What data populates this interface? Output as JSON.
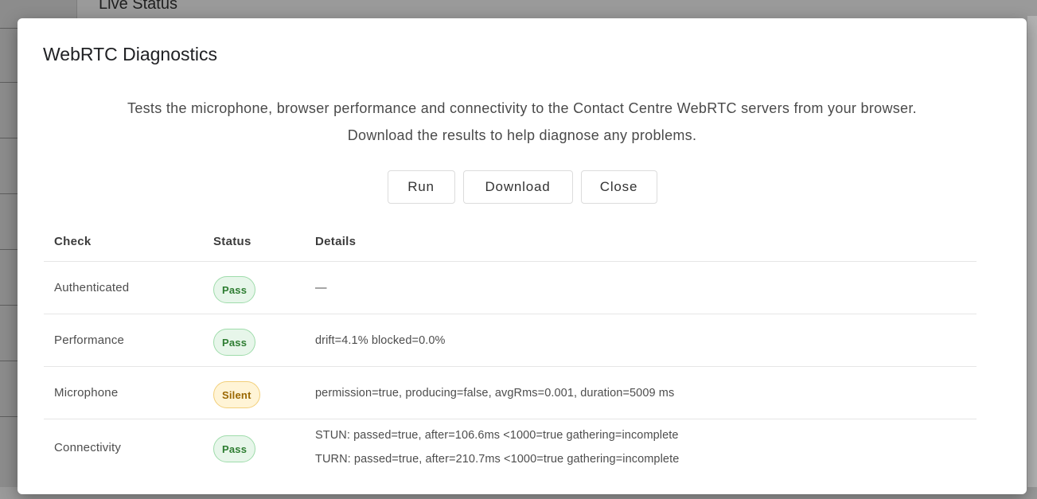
{
  "background": {
    "page_title": "Live Status"
  },
  "dialog": {
    "title": "WebRTC Diagnostics",
    "description_line1": "Tests the microphone, browser performance and connectivity to the Contact Centre WebRTC servers from your browser.",
    "description_line2": "Download the results to help diagnose any problems.",
    "buttons": {
      "run": "Run",
      "download": "Download",
      "close": "Close"
    }
  },
  "table": {
    "headers": {
      "check": "Check",
      "status": "Status",
      "details": "Details"
    },
    "rows": [
      {
        "check": "Authenticated",
        "status": "Pass",
        "status_kind": "pass",
        "details": [
          "—"
        ]
      },
      {
        "check": "Performance",
        "status": "Pass",
        "status_kind": "pass",
        "details": [
          "drift=4.1% blocked=0.0%"
        ]
      },
      {
        "check": "Microphone",
        "status": "Silent",
        "status_kind": "silent",
        "details": [
          "permission=true, producing=false, avgRms=0.001, duration=5009 ms"
        ]
      },
      {
        "check": "Connectivity",
        "status": "Pass",
        "status_kind": "pass",
        "details": [
          "STUN: passed=true, after=106.6ms <1000=true gathering=incomplete",
          "TURN: passed=true, after=210.7ms <1000=true gathering=incomplete"
        ]
      }
    ]
  },
  "colors": {
    "pass_text": "#2e7d32",
    "pass_bg": "#e7f6ea",
    "silent_text": "#9a6700",
    "silent_bg": "#fff4d6"
  }
}
